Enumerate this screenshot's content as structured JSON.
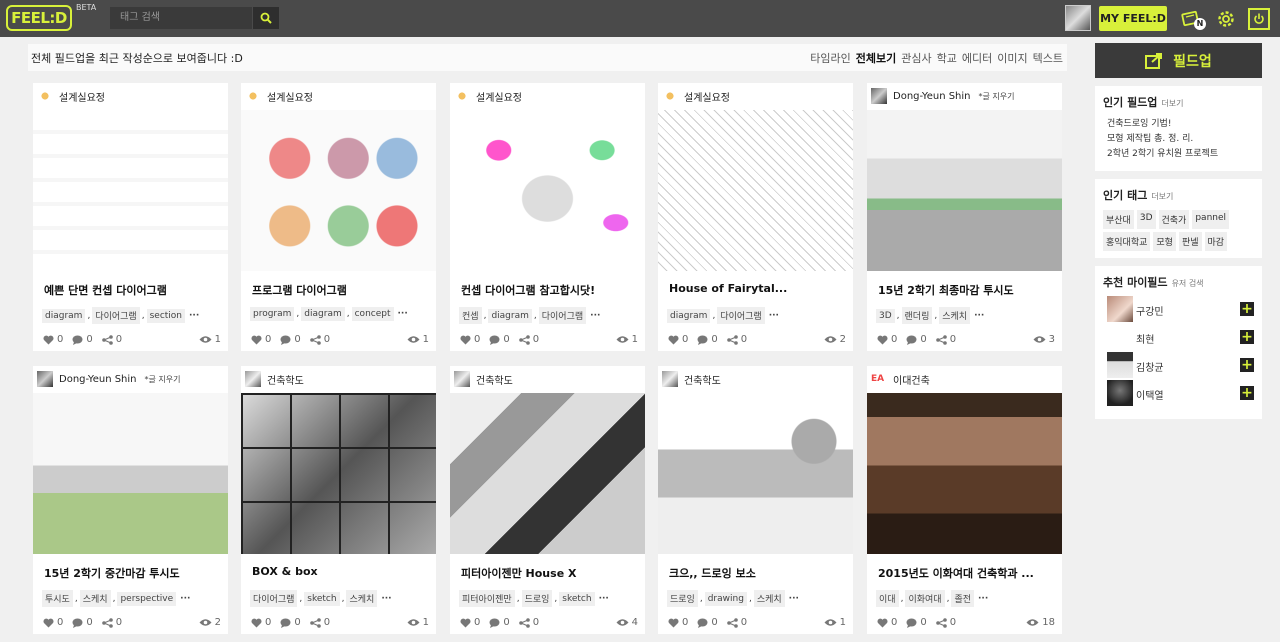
{
  "topbar": {
    "logo": "FEEL:D",
    "beta": "BETA",
    "search_placeholder": "태그 검색",
    "my_feeld": "MY FEEL:D",
    "notif_badge": "N"
  },
  "subbar": {
    "intro": "전체 필드업을 최근 작성순으로 보여줍니다 :D",
    "tabs": [
      "타임라인",
      "전체보기",
      "관심사",
      "학교",
      "에디터",
      "이미지",
      "텍스트"
    ],
    "active_tab": "전체보기"
  },
  "cards": [
    {
      "author": "설계실요정",
      "note": "",
      "title": "예쁜 단면 컨셉 다이어그램",
      "tags": [
        "diagram",
        "다이어그램",
        "section"
      ],
      "likes": "0",
      "comments": "0",
      "shares": "0",
      "views": "1"
    },
    {
      "author": "설계실요정",
      "note": "",
      "title": "프로그램 다이어그램",
      "tags": [
        "program",
        "diagram",
        "concept"
      ],
      "likes": "0",
      "comments": "0",
      "shares": "0",
      "views": "1"
    },
    {
      "author": "설계실요정",
      "note": "",
      "title": "컨셉 다이어그램 참고합시닷!",
      "tags": [
        "컨셉",
        "diagram",
        "다이어그램"
      ],
      "likes": "0",
      "comments": "0",
      "shares": "0",
      "views": "1"
    },
    {
      "author": "설계실요정",
      "note": "",
      "title": "House of Fairytal...",
      "tags": [
        "diagram",
        "다이어그램"
      ],
      "likes": "0",
      "comments": "0",
      "shares": "0",
      "views": "2"
    },
    {
      "author": "Dong-Yeun Shin",
      "note": "*글 지우기",
      "title": "15년 2학기 최종마감 투시도",
      "tags": [
        "3D",
        "랜더링",
        "스케치"
      ],
      "likes": "0",
      "comments": "0",
      "shares": "0",
      "views": "3"
    },
    {
      "author": "Dong-Yeun Shin",
      "note": "*글 지우기",
      "title": "15년 2학기 중간마감 투시도",
      "tags": [
        "투시도",
        "스케치",
        "perspective"
      ],
      "likes": "0",
      "comments": "0",
      "shares": "0",
      "views": "2"
    },
    {
      "author": "건축학도",
      "note": "",
      "title": "BOX & box",
      "tags": [
        "다이어그램",
        "sketch",
        "스케치"
      ],
      "likes": "0",
      "comments": "0",
      "shares": "0",
      "views": "1"
    },
    {
      "author": "건축학도",
      "note": "",
      "title": "피터아이젠만 House X",
      "tags": [
        "피터아이젠만",
        "드로잉",
        "sketch"
      ],
      "likes": "0",
      "comments": "0",
      "shares": "0",
      "views": "4"
    },
    {
      "author": "건축학도",
      "note": "",
      "title": "크으,, 드로잉 보소",
      "tags": [
        "드로잉",
        "drawing",
        "스케치"
      ],
      "likes": "0",
      "comments": "0",
      "shares": "0",
      "views": "1"
    },
    {
      "author": "이대건축",
      "note": "",
      "title": "2015년도 이화여대 건축학과 ...",
      "tags": [
        "이대",
        "이화여대",
        "졸전"
      ],
      "likes": "0",
      "comments": "0",
      "shares": "0",
      "views": "18"
    }
  ],
  "sidebar": {
    "upload_label": "필드업",
    "popular_feeld": {
      "title": "인기 필드업",
      "more": "더보기",
      "items": [
        "건축드로잉 기법!",
        "모형 제작팁 총. 정. 리.",
        "2학년 2학기 유치원 프로젝트"
      ]
    },
    "popular_tags": {
      "title": "인기 태그",
      "more": "더보기",
      "items": [
        "부산대",
        "3D",
        "건축가",
        "pannel",
        "홍익대학교",
        "모형",
        "판넬",
        "마감"
      ]
    },
    "recommend": {
      "title": "추천 마이필드",
      "sub": "유저 검색",
      "users": [
        "구강민",
        "최현",
        "김창균",
        "이택열"
      ]
    }
  }
}
